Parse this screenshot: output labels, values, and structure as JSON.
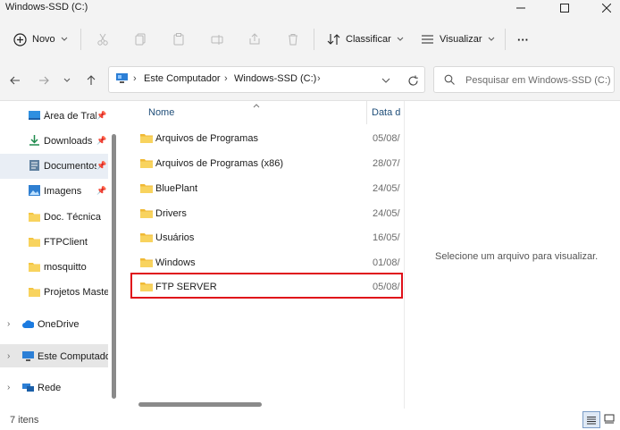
{
  "window": {
    "title": "Windows-SSD (C:)"
  },
  "toolbar": {
    "new_label": "Novo",
    "sort_label": "Classificar",
    "view_label": "Visualizar",
    "more_label": "···"
  },
  "address": {
    "crumbs": [
      "Este Computador",
      "Windows-SSD (C:)"
    ],
    "search_placeholder": "Pesquisar em Windows-SSD (C:)"
  },
  "sidebar": {
    "items": [
      {
        "label": "Área de Trab",
        "icon": "desktop-icon",
        "pinned": true
      },
      {
        "label": "Downloads",
        "icon": "download-icon",
        "pinned": true
      },
      {
        "label": "Documentos",
        "icon": "document-icon",
        "pinned": true,
        "selected": true
      },
      {
        "label": "Imagens",
        "icon": "image-icon",
        "pinned": true
      },
      {
        "label": "Doc. Técnica",
        "icon": "folder-icon"
      },
      {
        "label": "FTPClient",
        "icon": "folder-icon"
      },
      {
        "label": "mosquitto",
        "icon": "folder-icon"
      },
      {
        "label": "Projetos Master",
        "icon": "folder-icon"
      },
      {
        "label": "OneDrive",
        "icon": "cloud-icon",
        "expandable": true
      },
      {
        "label": "Este Computado",
        "icon": "computer-icon",
        "expandable": true,
        "selected": true
      },
      {
        "label": "Rede",
        "icon": "network-icon",
        "expandable": true
      }
    ]
  },
  "files": {
    "headers": {
      "name": "Nome",
      "date": "Data d"
    },
    "rows": [
      {
        "name": "Arquivos de Programas",
        "date": "05/08/"
      },
      {
        "name": "Arquivos de Programas (x86)",
        "date": "28/07/"
      },
      {
        "name": "BluePlant",
        "date": "24/05/"
      },
      {
        "name": "Drivers",
        "date": "24/05/"
      },
      {
        "name": "Usuários",
        "date": "16/05/"
      },
      {
        "name": "Windows",
        "date": "01/08/"
      },
      {
        "name": "FTP SERVER",
        "date": "05/08/",
        "highlighted": true
      }
    ]
  },
  "preview": {
    "text": "Selecione um arquivo para visualizar."
  },
  "status": {
    "count": "7 itens"
  },
  "colors": {
    "accent": "#0067c0",
    "highlight_border": "#e0101a",
    "folder": "#f4c542",
    "selected_bg": "#e9eef5"
  }
}
